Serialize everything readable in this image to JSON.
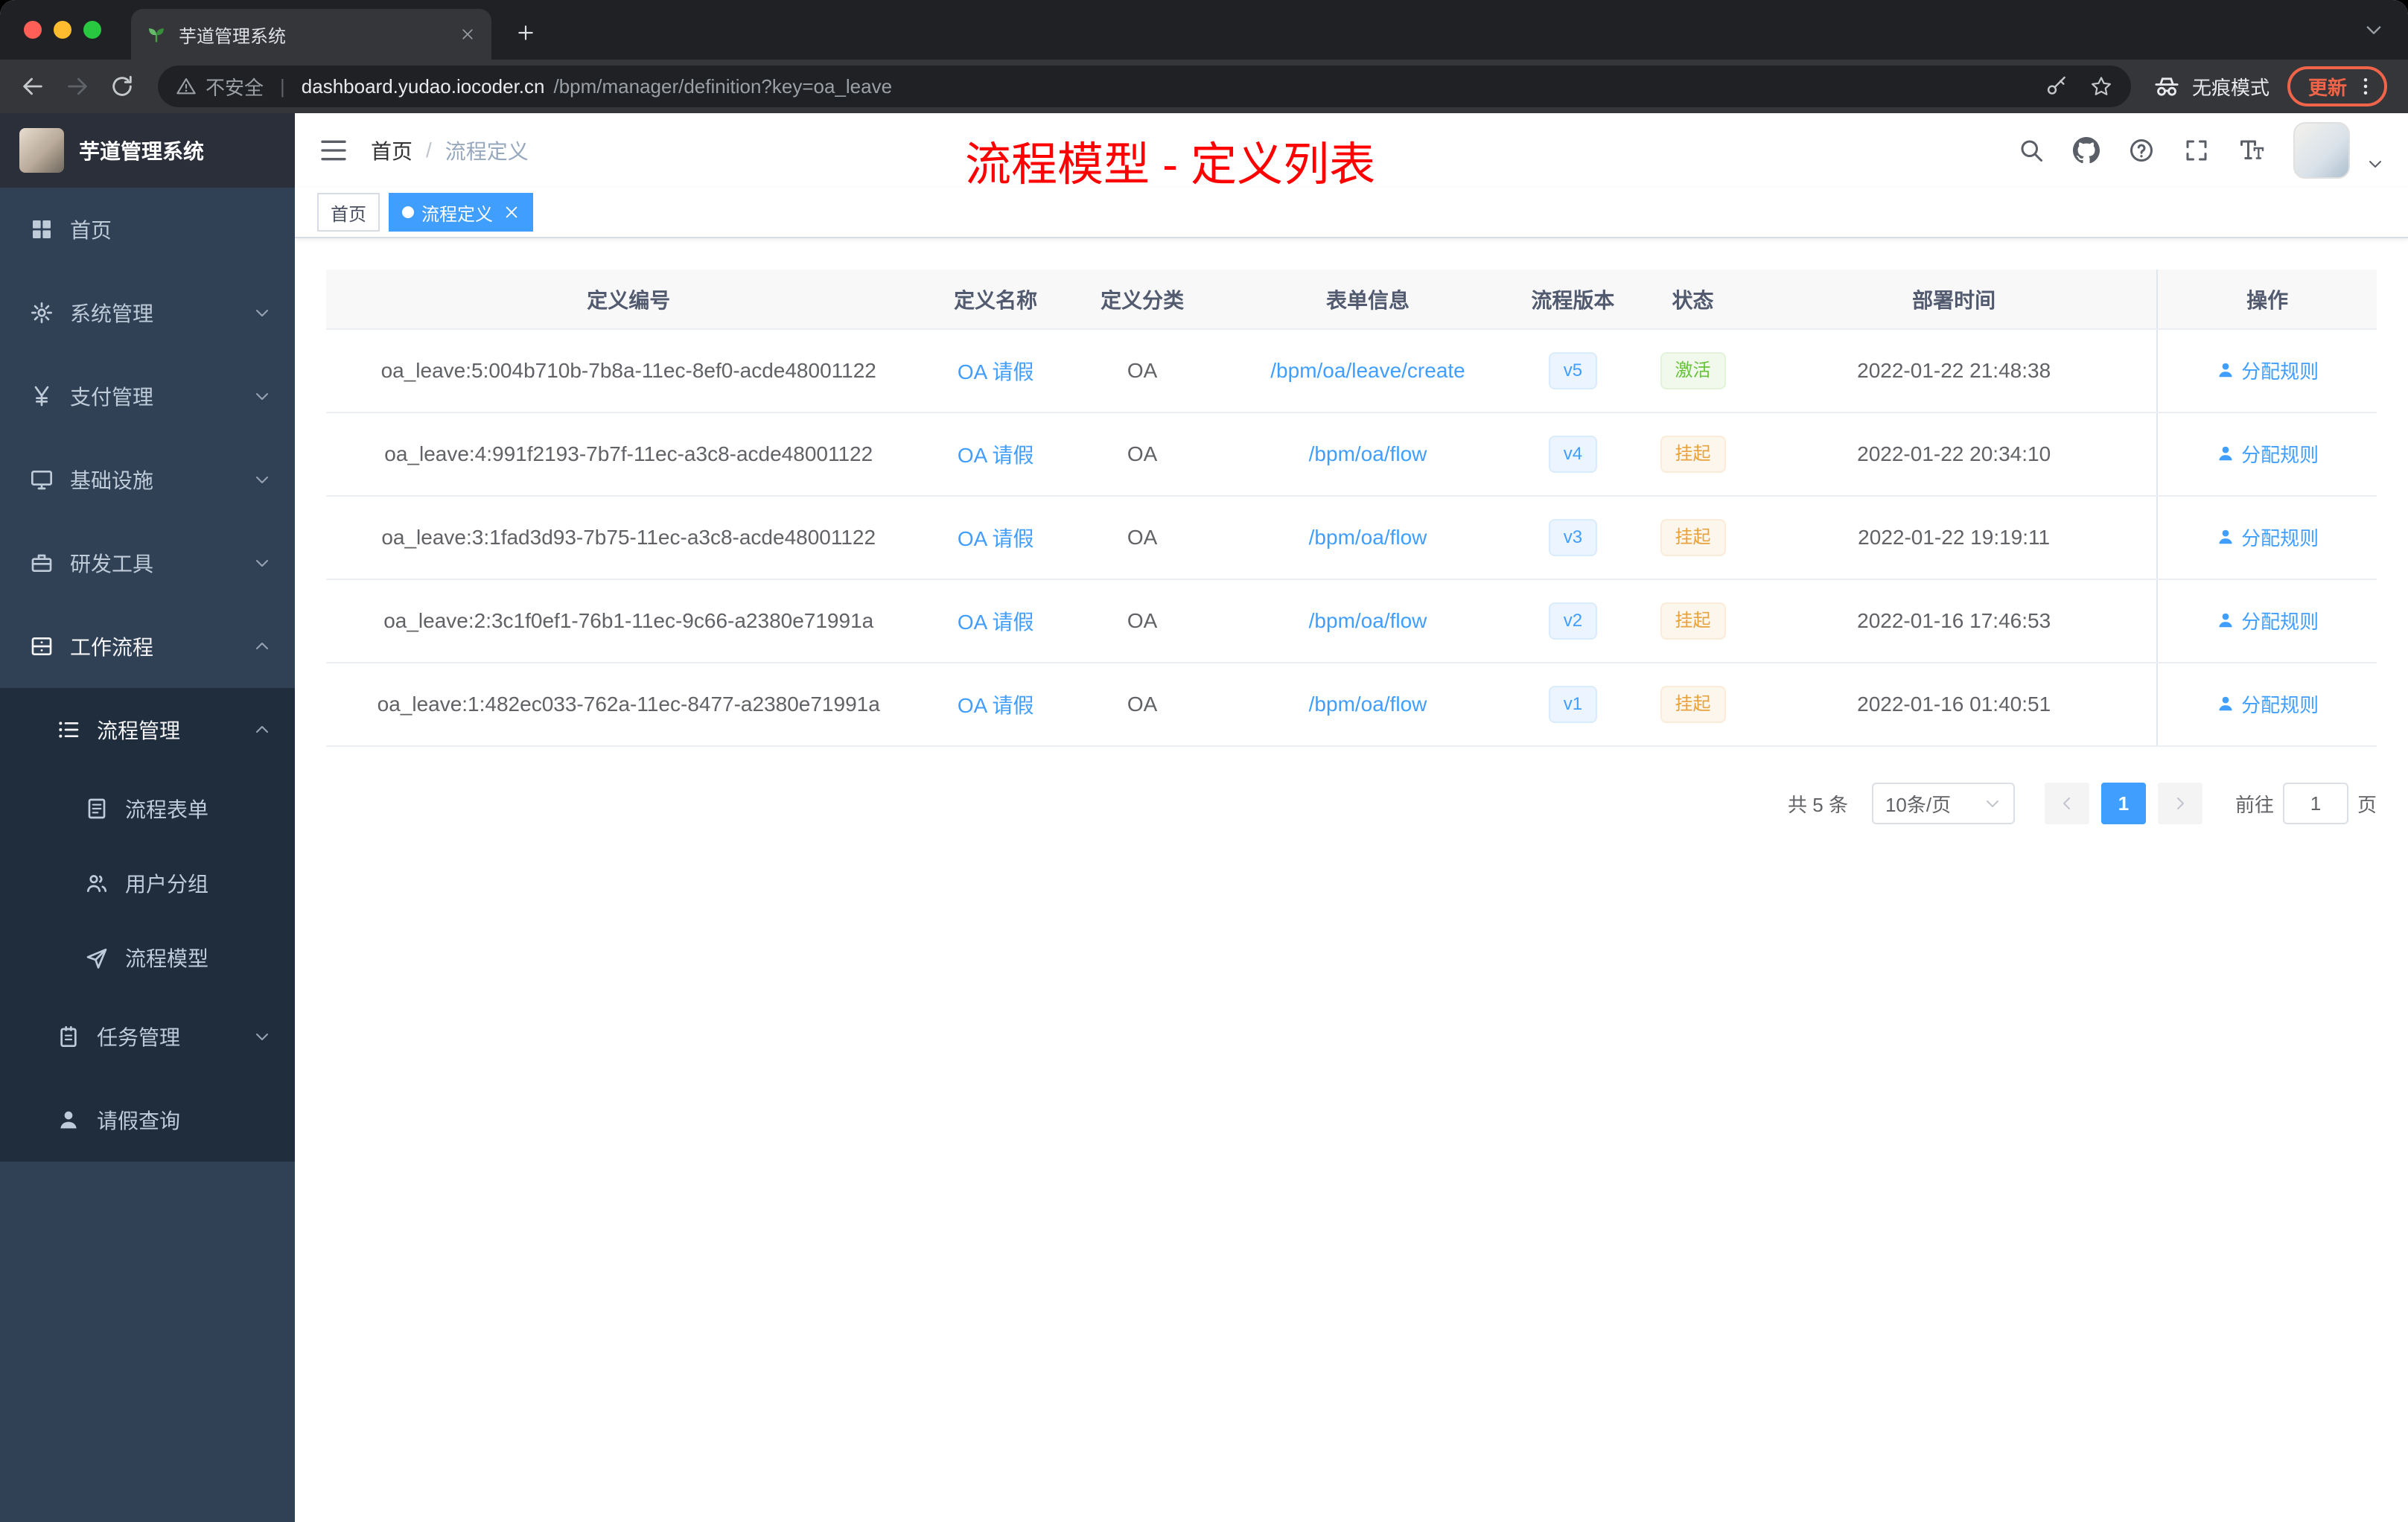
{
  "colors": {
    "accent": "#409eff",
    "success": "#67c23a",
    "warning": "#e6a23c",
    "annotation": "#ff0000",
    "sidebar_bg": "#304156",
    "sidebar_sub_bg": "#1f2d3d"
  },
  "browser": {
    "tab_title": "芋道管理系统",
    "security_label": "不安全",
    "url_host": "dashboard.yudao.iocoder.cn",
    "url_path": "/bpm/manager/definition?key=oa_leave",
    "incognito_label": "无痕模式",
    "update_label": "更新"
  },
  "sidebar": {
    "logo_title": "芋道管理系统",
    "menu": [
      {
        "name": "home",
        "label": "首页",
        "icon": "dashboard",
        "level": 0
      },
      {
        "name": "system-management",
        "label": "系统管理",
        "icon": "gear",
        "level": 0,
        "chevron": "down"
      },
      {
        "name": "payment-management",
        "label": "支付管理",
        "icon": "yen",
        "level": 0,
        "chevron": "down"
      },
      {
        "name": "infrastructure",
        "label": "基础设施",
        "icon": "monitor",
        "level": 0,
        "chevron": "down"
      },
      {
        "name": "dev-tools",
        "label": "研发工具",
        "icon": "toolbox",
        "level": 0,
        "chevron": "down"
      },
      {
        "name": "workflow",
        "label": "工作流程",
        "icon": "drawer",
        "level": 0,
        "chevron": "up",
        "active": true
      },
      {
        "name": "process-management",
        "label": "流程管理",
        "icon": "list",
        "level": 1,
        "chevron": "up",
        "dark": true,
        "active": true
      },
      {
        "name": "process-form",
        "label": "流程表单",
        "icon": "form",
        "level": 2,
        "dark": true
      },
      {
        "name": "user-group",
        "label": "用户分组",
        "icon": "user-group",
        "level": 2,
        "dark": true
      },
      {
        "name": "process-model",
        "label": "流程模型",
        "icon": "send",
        "level": 2,
        "dark": true
      },
      {
        "name": "task-management",
        "label": "任务管理",
        "icon": "task",
        "level": 1,
        "chevron": "down",
        "dark": true
      },
      {
        "name": "leave-query",
        "label": "请假查询",
        "icon": "user",
        "level": 1,
        "dark": true
      }
    ]
  },
  "header": {
    "breadcrumb": [
      {
        "label": "首页"
      },
      {
        "label": "流程定义"
      }
    ],
    "separator": "/",
    "annotation": "流程模型 - 定义列表"
  },
  "tags": [
    {
      "name": "tag-home",
      "label": "首页",
      "active": false,
      "closable": false
    },
    {
      "name": "tag-process-definition",
      "label": "流程定义",
      "active": true,
      "closable": true
    }
  ],
  "table": {
    "columns": [
      {
        "label": "定义编号",
        "key": "id",
        "width": "29.5%"
      },
      {
        "label": "定义名称",
        "key": "name",
        "width": "6.3%"
      },
      {
        "label": "定义分类",
        "key": "category",
        "width": "8%"
      },
      {
        "label": "表单信息",
        "key": "form",
        "width": "14%"
      },
      {
        "label": "流程版本",
        "key": "version",
        "width": "6%"
      },
      {
        "label": "状态",
        "key": "status",
        "width": "5.7%"
      },
      {
        "label": "部署时间",
        "key": "deploy_time",
        "width": "19.8%"
      },
      {
        "label": "操作",
        "key": "action",
        "width": "10.7%"
      }
    ],
    "rows": [
      {
        "id": "oa_leave:5:004b710b-7b8a-11ec-8ef0-acde48001122",
        "name": "OA 请假",
        "category": "OA",
        "form": "/bpm/oa/leave/create",
        "version": "v5",
        "status": "激活",
        "status_type": "success",
        "deploy_time": "2022-01-22 21:48:38",
        "action": "分配规则"
      },
      {
        "id": "oa_leave:4:991f2193-7b7f-11ec-a3c8-acde48001122",
        "name": "OA 请假",
        "category": "OA",
        "form": "/bpm/oa/flow",
        "version": "v4",
        "status": "挂起",
        "status_type": "warning",
        "deploy_time": "2022-01-22 20:34:10",
        "action": "分配规则"
      },
      {
        "id": "oa_leave:3:1fad3d93-7b75-11ec-a3c8-acde48001122",
        "name": "OA 请假",
        "category": "OA",
        "form": "/bpm/oa/flow",
        "version": "v3",
        "status": "挂起",
        "status_type": "warning",
        "deploy_time": "2022-01-22 19:19:11",
        "action": "分配规则"
      },
      {
        "id": "oa_leave:2:3c1f0ef1-76b1-11ec-9c66-a2380e71991a",
        "name": "OA 请假",
        "category": "OA",
        "form": "/bpm/oa/flow",
        "version": "v2",
        "status": "挂起",
        "status_type": "warning",
        "deploy_time": "2022-01-16 17:46:53",
        "action": "分配规则"
      },
      {
        "id": "oa_leave:1:482ec033-762a-11ec-8477-a2380e71991a",
        "name": "OA 请假",
        "category": "OA",
        "form": "/bpm/oa/flow",
        "version": "v1",
        "status": "挂起",
        "status_type": "warning",
        "deploy_time": "2022-01-16 01:40:51",
        "action": "分配规则"
      }
    ]
  },
  "pagination": {
    "total": "共 5 条",
    "page_size": "10条/页",
    "current_page": "1",
    "goto_label": "前往",
    "goto_value": "1",
    "page_unit": "页"
  }
}
